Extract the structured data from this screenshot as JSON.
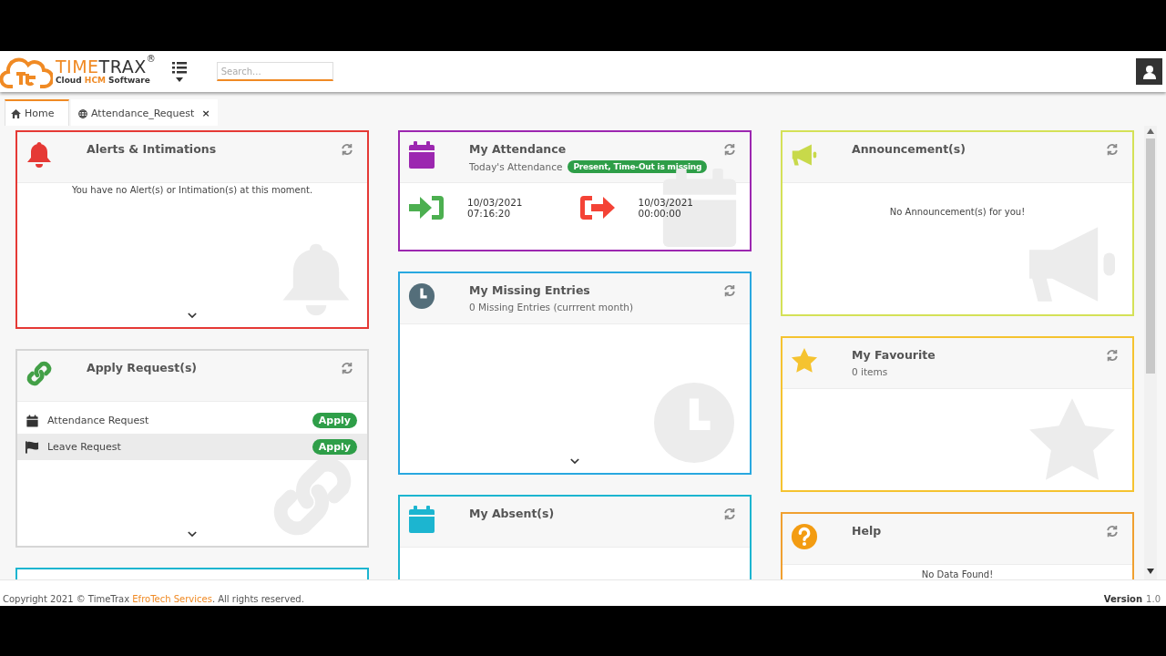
{
  "header": {
    "brand": [
      "TIME",
      "TRAX"
    ],
    "registered": "®",
    "tagline": [
      "Cloud ",
      "HCM",
      " Software"
    ],
    "search": {
      "placeholder": "Search..."
    }
  },
  "tabs": [
    {
      "label": "Home",
      "kind": "home",
      "selected": true
    },
    {
      "label": "Attendance_Request",
      "kind": "page",
      "selected": false,
      "close": "×"
    }
  ],
  "columns": [
    {
      "cards": [
        {
          "kind": "alerts",
          "title": "Alerts & Intimations",
          "color": "#e53935",
          "message": "You have no Alert(s) or Intimation(s) at this moment."
        },
        {
          "kind": "requests",
          "title": "Apply Request(s)",
          "color": "#d6d6d6",
          "rows": [
            {
              "label": "Attendance Request",
              "kind": "attendance",
              "action": "Apply",
              "hovered": false
            },
            {
              "label": "Leave Request",
              "kind": "leave",
              "action": "Apply",
              "hovered": true
            }
          ]
        },
        {
          "kind": "partial",
          "color": "#1cb5d0"
        }
      ]
    },
    {
      "cards": [
        {
          "kind": "attendance",
          "title": "My Attendance",
          "subtitle": "Today's Attendance",
          "badge": "Present, Time-Out is missing",
          "color": "#9c27b0",
          "time_in": {
            "date": "10/03/2021",
            "time": "07:16:20"
          },
          "time_out": {
            "date": "10/03/2021",
            "time": "00:00:00"
          }
        },
        {
          "kind": "missing",
          "title": "My Missing Entries",
          "subtitle": "0 Missing Entries (currrent month)",
          "color": "#29a8e0"
        },
        {
          "kind": "absent",
          "title": "My Absent(s)",
          "color": "#1cb5d0"
        }
      ]
    },
    {
      "cards": [
        {
          "kind": "announcements",
          "title": "Announcement(s)",
          "color": "#d4e157",
          "message": "No Announcement(s) for you!"
        },
        {
          "kind": "favourite",
          "title": "My Favourite",
          "subtitle": "0 items",
          "color": "#f5c330"
        },
        {
          "kind": "help",
          "title": "Help",
          "color": "#f0a030",
          "message": "No Data Found!"
        }
      ]
    }
  ],
  "footer": {
    "copyright": "Copyright 2021 © TimeTrax ",
    "link": "EfroTech Services",
    "rest": ". All rights reserved.",
    "version_label": "Version",
    "version": "1.0"
  }
}
